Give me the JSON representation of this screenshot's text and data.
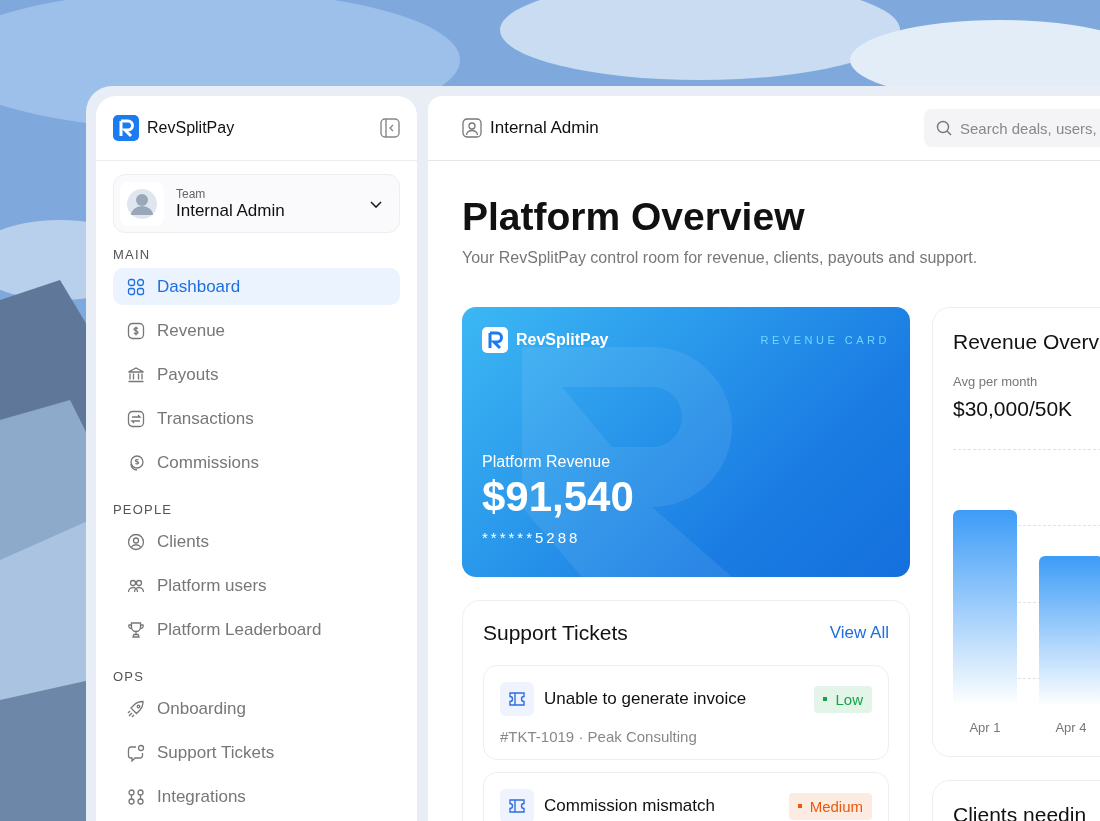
{
  "sidebar": {
    "brand": "RevSplitPay",
    "team": {
      "label": "Team",
      "name": "Internal Admin"
    },
    "sections": [
      {
        "title": "MAIN",
        "items": [
          {
            "label": "Dashboard",
            "selected": true
          },
          {
            "label": "Revenue",
            "selected": false
          },
          {
            "label": "Payouts",
            "selected": false
          },
          {
            "label": "Transactions",
            "selected": false
          },
          {
            "label": "Commissions",
            "selected": false
          }
        ]
      },
      {
        "title": "PEOPLE",
        "items": [
          {
            "label": "Clients",
            "selected": false
          },
          {
            "label": "Platform users",
            "selected": false
          },
          {
            "label": "Platform Leaderboard",
            "selected": false
          }
        ]
      },
      {
        "title": "OPS",
        "items": [
          {
            "label": "Onboarding",
            "selected": false
          },
          {
            "label": "Support Tickets",
            "selected": false
          },
          {
            "label": "Integrations",
            "selected": false
          }
        ]
      }
    ]
  },
  "header": {
    "user": "Internal Admin",
    "search": {
      "placeholder": "Search deals, users,"
    }
  },
  "page": {
    "title": "Platform Overview",
    "subtitle": "Your RevSplitPay control room for revenue, clients, payouts and support."
  },
  "revenue_card": {
    "brand": "RevSplitPay",
    "tag": "REVENUE CARD",
    "label": "Platform Revenue",
    "amount": "$91,540",
    "number": "******5288"
  },
  "support_tickets": {
    "title": "Support Tickets",
    "link": "View All",
    "tickets": [
      {
        "title": "Unable to generate invoice",
        "priority": "Low",
        "color": "#16a34a",
        "meta": "#TKT-1019 · Peak Consulting"
      },
      {
        "title": "Commission mismatch",
        "priority": "Medium",
        "color": "#ea580c"
      }
    ]
  },
  "revenue_overview": {
    "title": "Revenue Overv",
    "caption": "Avg per month",
    "value": "$30,000/50K",
    "x_labels": [
      "Apr 1",
      "Apr 4"
    ]
  },
  "clients_card": {
    "title": "Clients needin"
  }
}
